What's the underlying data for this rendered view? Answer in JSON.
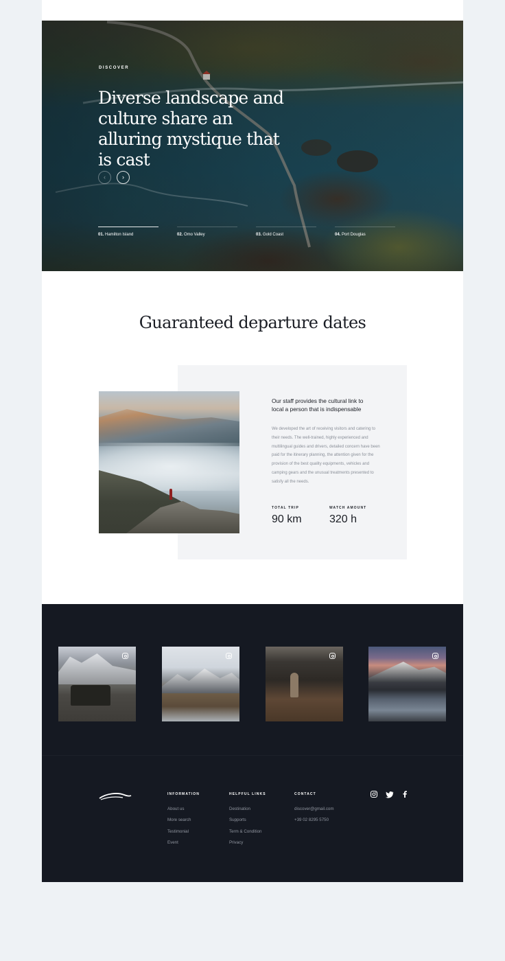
{
  "hero": {
    "eyebrow": "DISCOVER",
    "title": "Diverse landscape and culture share an alluring mystique that is cast",
    "prev_icon": "‹",
    "next_icon": "›",
    "destinations": [
      {
        "num": "01.",
        "name": "Hamilton Island"
      },
      {
        "num": "02.",
        "name": "Omo Valley"
      },
      {
        "num": "03.",
        "name": "Gold Coast"
      },
      {
        "num": "04.",
        "name": "Port Douglas"
      }
    ],
    "active_index": 0
  },
  "departures": {
    "title": "Guaranteed departure dates",
    "lead": "Our staff provides the cultural link to local a person that is indispensable",
    "body": "We developed the art of receiving visitors and catering to their needs. The well-trained, highly experienced and multilingual guides and drivers, detailed concern have been paid for the itinerary planning, the attention given for the provision of the best quality equipments, vehicles and camping gears and the unusual treatments presented to satisfy all the needs.",
    "stats": [
      {
        "label": "TOTAL TRIP",
        "value": "90 km"
      },
      {
        "label": "WATCH AMOUNT",
        "value": "320 h"
      }
    ]
  },
  "instagram": {
    "icon": "instagram-icon",
    "posts": [
      "jeep-in-snow",
      "snowy-mountain-valley",
      "hikers-on-trail",
      "mountain-lake-sunset"
    ]
  },
  "footer": {
    "logo": "wave-logo",
    "columns": [
      {
        "heading": "INFORMATION",
        "links": [
          "About us",
          "More search",
          "Testimonial",
          "Event"
        ]
      },
      {
        "heading": "HELPFUL LINKS",
        "links": [
          "Destination",
          "Supports",
          "Term & Condition",
          "Privacy"
        ]
      },
      {
        "heading": "CONTACT",
        "links": [
          "discover@gmail.com",
          "+39 02 8295 5750"
        ]
      }
    ],
    "social": [
      "instagram-icon",
      "twitter-icon",
      "facebook-icon"
    ]
  },
  "colors": {
    "background": "#eef2f5",
    "dark": "#151922",
    "text": "#1a1d24",
    "muted": "#8a8f98",
    "card": "#f3f4f6"
  }
}
